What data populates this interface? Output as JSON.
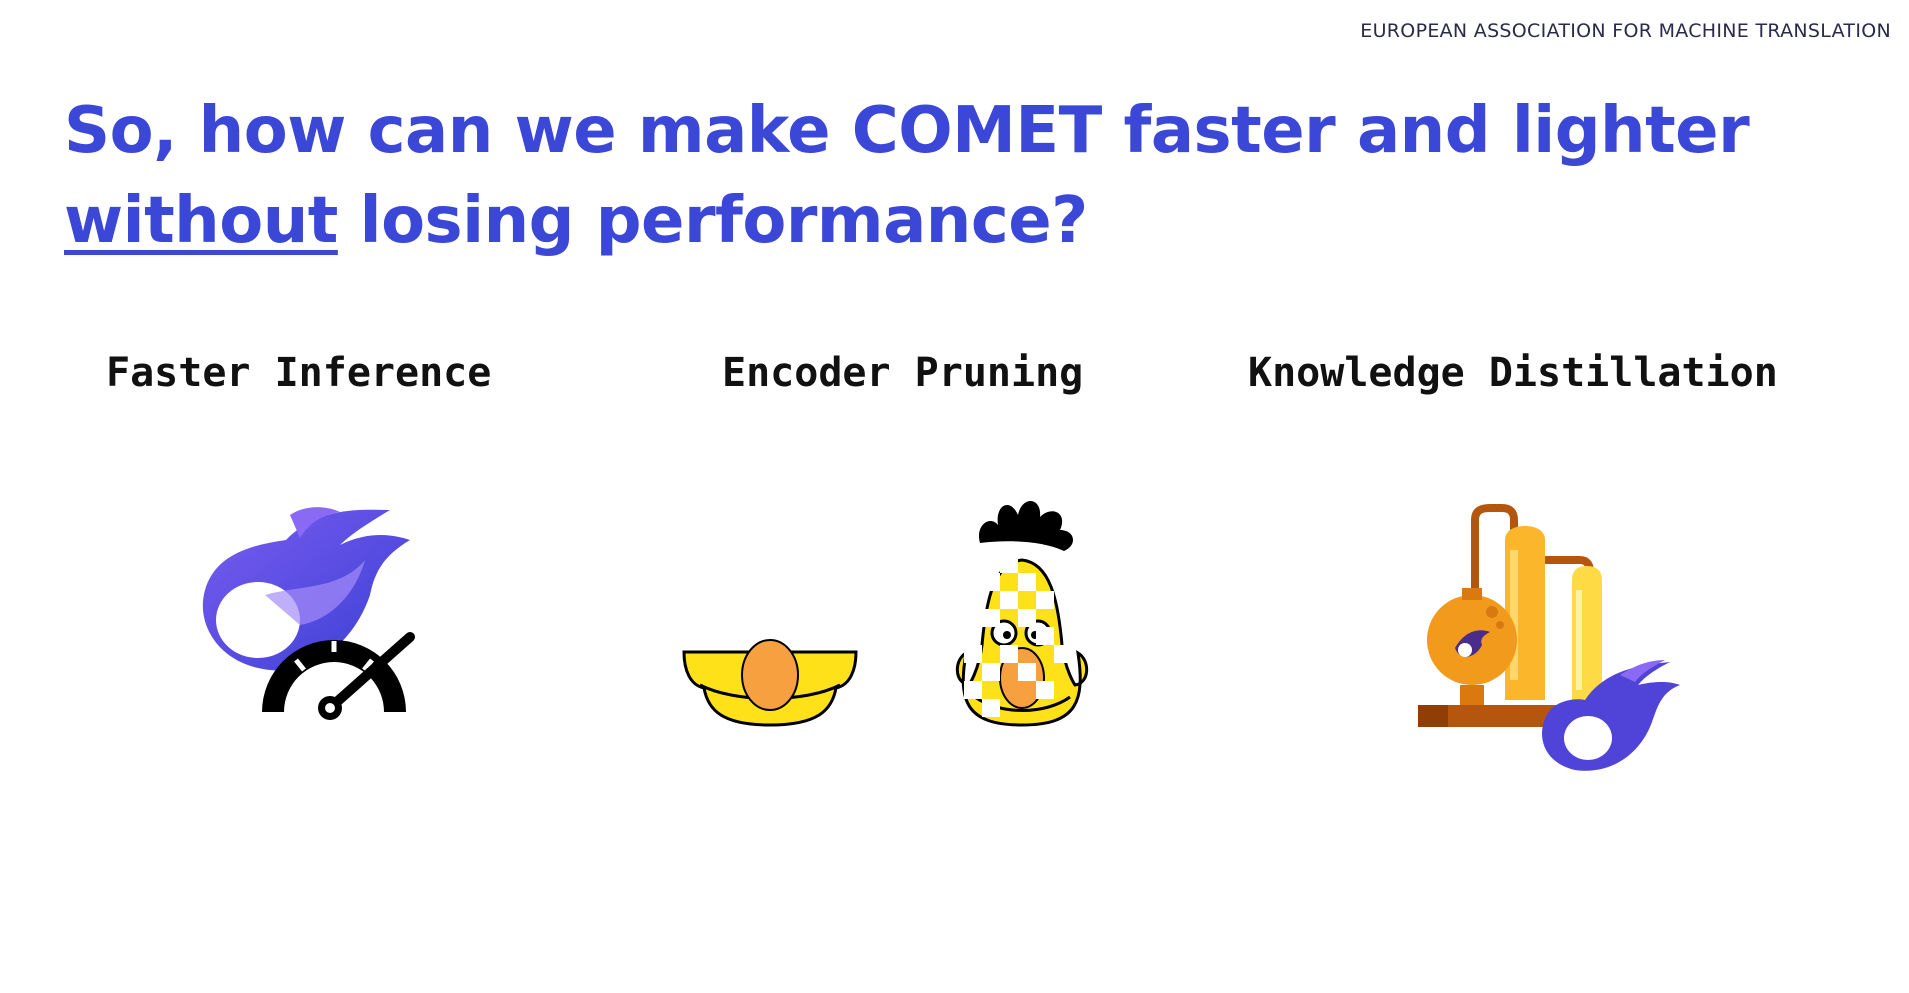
{
  "header": {
    "org": "EUROPEAN ASSOCIATION FOR MACHINE TRANSLATION"
  },
  "slide": {
    "title_part1": "So, how can we make COMET faster and lighter",
    "title_underlined": "without",
    "title_part2": " losing performance?"
  },
  "columns": [
    {
      "label": "Faster Inference",
      "icon": "comet-speedometer-icon"
    },
    {
      "label": "Encoder Pruning",
      "icon": "pruned-muppet-icon"
    },
    {
      "label": "Knowledge Distillation",
      "icon": "distillery-comet-icon"
    }
  ],
  "colors": {
    "accent": "#3b47d6",
    "comet_purple": "#6b4fe0",
    "bert_yellow": "#ffe11a",
    "nose_orange": "#f6a040",
    "distill_orange": "#f29a1c",
    "distill_brown": "#b4560e"
  }
}
